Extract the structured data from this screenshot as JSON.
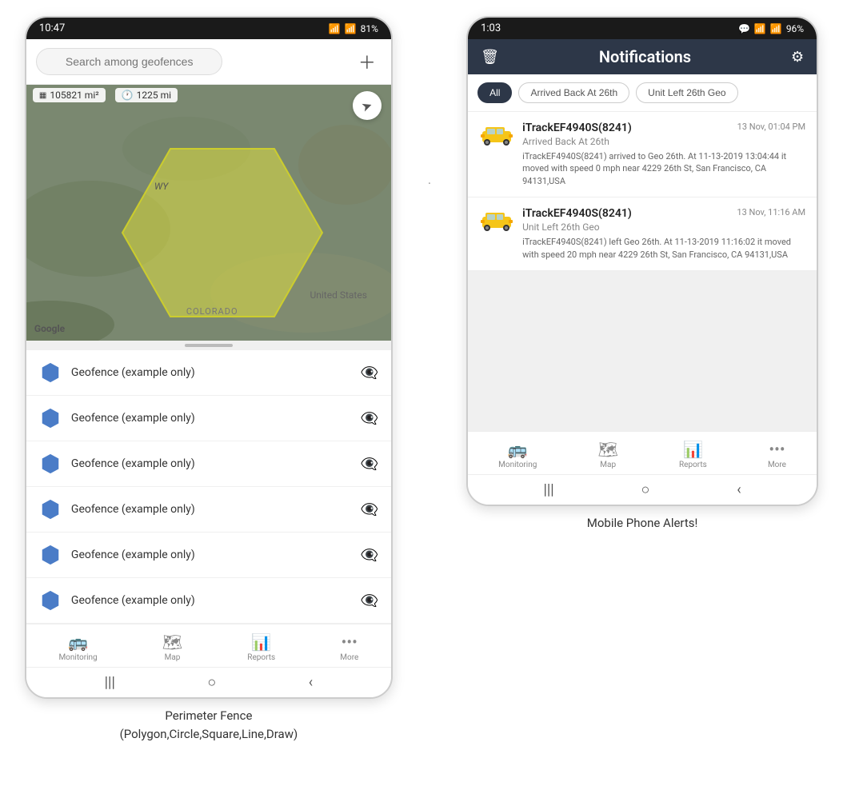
{
  "left_phone": {
    "status_bar": {
      "time": "10:47",
      "wifi": "WiFi",
      "signal": "Signal",
      "battery": "81%"
    },
    "search": {
      "placeholder": "Search among geofences"
    },
    "map": {
      "stat1": "105821 mi²",
      "stat2": "1225 mi",
      "label_wy": "WY",
      "label_us": "United States",
      "label_co": "COLORADO"
    },
    "geofences": [
      {
        "name": "Geofence (example only)"
      },
      {
        "name": "Geofence (example only)"
      },
      {
        "name": "Geofence (example only)"
      },
      {
        "name": "Geofence (example only)"
      },
      {
        "name": "Geofence (example only)"
      },
      {
        "name": "Geofence (example only)"
      }
    ],
    "nav": [
      {
        "label": "Monitoring",
        "icon": "🚌"
      },
      {
        "label": "Map",
        "icon": "🗺"
      },
      {
        "label": "Reports",
        "icon": "📊"
      },
      {
        "label": "More",
        "icon": "···"
      }
    ],
    "caption": "Perimeter Fence\n(Polygon,Circle,Square,Line,Draw)"
  },
  "right_phone": {
    "status_bar": {
      "time": "1:03",
      "battery": "96%"
    },
    "header": {
      "title": "Notifications",
      "delete_icon": "🗑",
      "settings_icon": "⚙"
    },
    "filter_tabs": [
      {
        "label": "All",
        "active": true
      },
      {
        "label": "Arrived Back At 26th",
        "active": false
      },
      {
        "label": "Unit Left 26th Geo",
        "active": false
      }
    ],
    "notifications": [
      {
        "device": "iTrackEF4940S(8241)",
        "time": "13 Nov, 01:04 PM",
        "event": "Arrived Back At 26th",
        "desc": "iTrackEF4940S(8241) arrived to Geo 26th.    At 11-13-2019 13:04:44 it moved with speed 0 mph near 4229 26th St, San Francisco, CA 94131,USA"
      },
      {
        "device": "iTrackEF4940S(8241)",
        "time": "13 Nov, 11:16 AM",
        "event": "Unit Left 26th Geo",
        "desc": "iTrackEF4940S(8241) left Geo 26th.   At 11-13-2019 11:16:02 it moved with speed 20 mph near 4229 26th St, San Francisco, CA 94131,USA"
      }
    ],
    "nav": [
      {
        "label": "Monitoring",
        "icon": "🚌"
      },
      {
        "label": "Map",
        "icon": "🗺"
      },
      {
        "label": "Reports",
        "icon": "📊"
      },
      {
        "label": "More",
        "icon": "···"
      }
    ],
    "caption": "Mobile Phone Alerts!"
  }
}
